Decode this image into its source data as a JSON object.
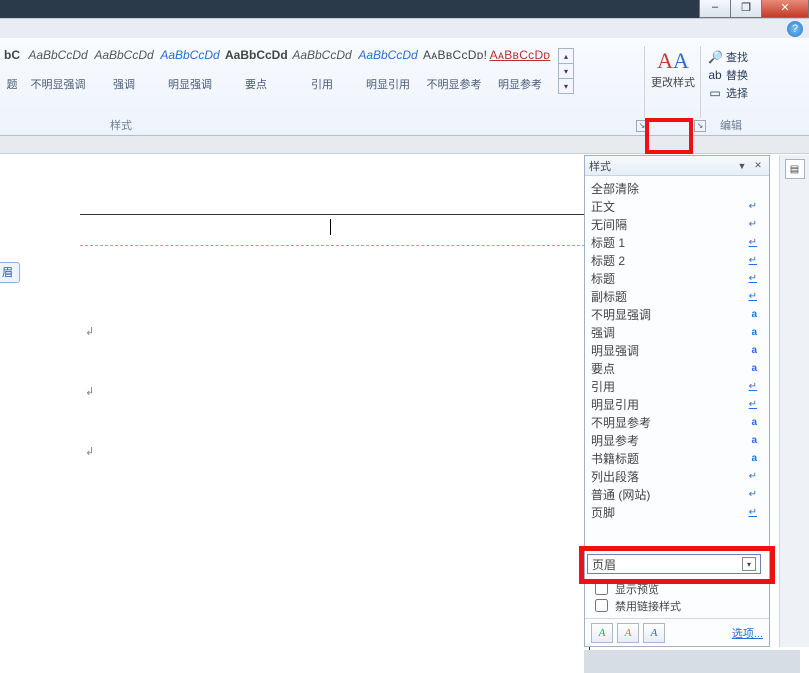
{
  "window": {
    "min": "–",
    "max": "❐",
    "close": "✕",
    "help": "?"
  },
  "ribbon": {
    "gallery": [
      {
        "sample": "bC",
        "label": "题",
        "cls": "first bold"
      },
      {
        "sample": "AaBbCcDd",
        "label": "不明显强调",
        "cls": "italic"
      },
      {
        "sample": "AaBbCcDd",
        "label": "强调",
        "cls": "italic"
      },
      {
        "sample": "AaBbCcDd",
        "label": "明显强调",
        "cls": "italic blue"
      },
      {
        "sample": "AaBbCcDd",
        "label": "要点",
        "cls": "bold"
      },
      {
        "sample": "AaBbCcDd",
        "label": "引用",
        "cls": "italic"
      },
      {
        "sample": "AaBbCcDd",
        "label": "明显引用",
        "cls": "italic blue"
      },
      {
        "sample": "AᴀBʙCᴄDᴅ!",
        "label": "不明显参考",
        "cls": "smallcaps"
      },
      {
        "sample": "AᴀBʙCᴄDᴅ",
        "label": "明显参考",
        "cls": "smallcaps red"
      }
    ],
    "scroll_up": "▴",
    "scroll_down": "▾",
    "scroll_more": "▾",
    "change_styles": "更改样式",
    "find": "查找",
    "replace": "替换",
    "select": "选择",
    "group_styles": "样式",
    "group_edit": "编辑",
    "launcher": "↘"
  },
  "doc": {
    "header_flag": "眉",
    "para": "↲"
  },
  "pane": {
    "title": "样式",
    "pin": "▼",
    "close": "✕",
    "items": [
      {
        "n": "全部清除",
        "t": ""
      },
      {
        "n": "正文",
        "t": "para"
      },
      {
        "n": "无间隔",
        "t": "para"
      },
      {
        "n": "标题 1",
        "t": "lpara"
      },
      {
        "n": "标题 2",
        "t": "lpara"
      },
      {
        "n": "标题",
        "t": "lpara"
      },
      {
        "n": "副标题",
        "t": "lpara"
      },
      {
        "n": "不明显强调",
        "t": "a"
      },
      {
        "n": "强调",
        "t": "a"
      },
      {
        "n": "明显强调",
        "t": "a"
      },
      {
        "n": "要点",
        "t": "a"
      },
      {
        "n": "引用",
        "t": "lpara"
      },
      {
        "n": "明显引用",
        "t": "lpara"
      },
      {
        "n": "不明显参考",
        "t": "a"
      },
      {
        "n": "明显参考",
        "t": "a"
      },
      {
        "n": "书籍标题",
        "t": "a"
      },
      {
        "n": "列出段落",
        "t": "para"
      },
      {
        "n": "普通 (网站)",
        "t": "para"
      },
      {
        "n": "页脚",
        "t": "lpara"
      }
    ],
    "selected": "页眉",
    "dd": "▾",
    "show_preview": "显示预览",
    "disable_linked": "禁用链接样式",
    "new": "A",
    "inspect": "A",
    "manage": "A",
    "options": "选项..."
  }
}
